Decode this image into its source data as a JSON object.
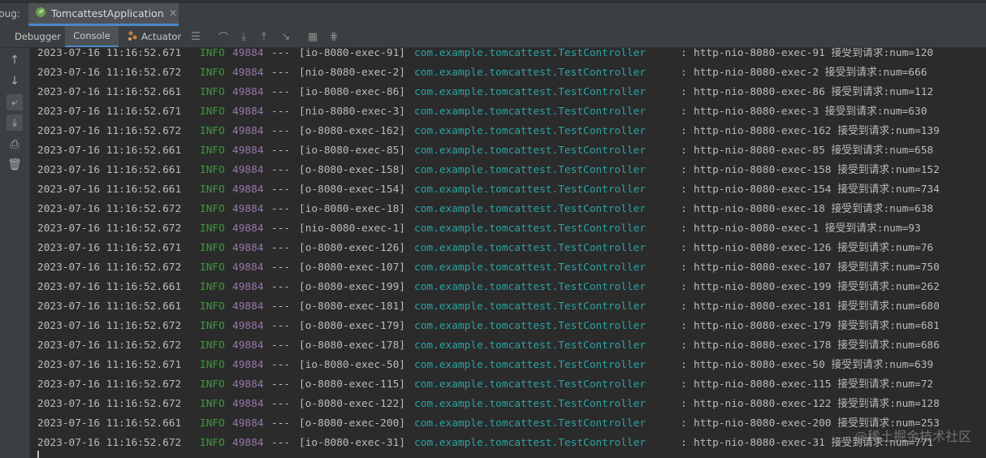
{
  "header": {
    "debug_label": "bug:",
    "app_tab_title": "TomcattestApplication",
    "close_glyph": "×"
  },
  "toolbar": {
    "tabs": [
      "Debugger",
      "Console",
      "Actuator"
    ],
    "icons": [
      "menu-icon",
      "restore-layout-icon",
      "step-over-icon",
      "step-into-icon",
      "step-out-icon",
      "run-to-cursor-icon",
      "evaluate-icon",
      "trace-icon"
    ]
  },
  "sidebar": {
    "icons": [
      "up-arrow-icon",
      "down-arrow-icon",
      "soft-wrap-icon",
      "scroll-to-end-icon",
      "print-icon",
      "trash-icon"
    ]
  },
  "colors": {
    "level": "#3d9a3d",
    "pid": "#9876aa",
    "logger": "#2ba3a3",
    "accent": "#4a88c7"
  },
  "console": {
    "lines": [
      {
        "date": "2023-07-16 11:16:52.671",
        "level": "INFO",
        "pid": "49884",
        "sep": "---",
        "thread": "[io-8080-exec-91]",
        "logger": "com.example.tomcattest.TestController",
        "colon": ":",
        "msg": "http-nio-8080-exec-91 接受到请求:num=120"
      },
      {
        "date": "2023-07-16 11:16:52.672",
        "level": "INFO",
        "pid": "49884",
        "sep": "---",
        "thread": "[nio-8080-exec-2]",
        "logger": "com.example.tomcattest.TestController",
        "colon": ":",
        "msg": "http-nio-8080-exec-2 接受到请求:num=666"
      },
      {
        "date": "2023-07-16 11:16:52.661",
        "level": "INFO",
        "pid": "49884",
        "sep": "---",
        "thread": "[io-8080-exec-86]",
        "logger": "com.example.tomcattest.TestController",
        "colon": ":",
        "msg": "http-nio-8080-exec-86 接受到请求:num=112"
      },
      {
        "date": "2023-07-16 11:16:52.671",
        "level": "INFO",
        "pid": "49884",
        "sep": "---",
        "thread": "[nio-8080-exec-3]",
        "logger": "com.example.tomcattest.TestController",
        "colon": ":",
        "msg": "http-nio-8080-exec-3 接受到请求:num=630"
      },
      {
        "date": "2023-07-16 11:16:52.672",
        "level": "INFO",
        "pid": "49884",
        "sep": "---",
        "thread": "[o-8080-exec-162]",
        "logger": "com.example.tomcattest.TestController",
        "colon": ":",
        "msg": "http-nio-8080-exec-162 接受到请求:num=139"
      },
      {
        "date": "2023-07-16 11:16:52.661",
        "level": "INFO",
        "pid": "49884",
        "sep": "---",
        "thread": "[io-8080-exec-85]",
        "logger": "com.example.tomcattest.TestController",
        "colon": ":",
        "msg": "http-nio-8080-exec-85 接受到请求:num=658"
      },
      {
        "date": "2023-07-16 11:16:52.661",
        "level": "INFO",
        "pid": "49884",
        "sep": "---",
        "thread": "[o-8080-exec-158]",
        "logger": "com.example.tomcattest.TestController",
        "colon": ":",
        "msg": "http-nio-8080-exec-158 接受到请求:num=152"
      },
      {
        "date": "2023-07-16 11:16:52.661",
        "level": "INFO",
        "pid": "49884",
        "sep": "---",
        "thread": "[o-8080-exec-154]",
        "logger": "com.example.tomcattest.TestController",
        "colon": ":",
        "msg": "http-nio-8080-exec-154 接受到请求:num=734"
      },
      {
        "date": "2023-07-16 11:16:52.672",
        "level": "INFO",
        "pid": "49884",
        "sep": "---",
        "thread": "[io-8080-exec-18]",
        "logger": "com.example.tomcattest.TestController",
        "colon": ":",
        "msg": "http-nio-8080-exec-18 接受到请求:num=638"
      },
      {
        "date": "2023-07-16 11:16:52.672",
        "level": "INFO",
        "pid": "49884",
        "sep": "---",
        "thread": "[nio-8080-exec-1]",
        "logger": "com.example.tomcattest.TestController",
        "colon": ":",
        "msg": "http-nio-8080-exec-1 接受到请求:num=93"
      },
      {
        "date": "2023-07-16 11:16:52.671",
        "level": "INFO",
        "pid": "49884",
        "sep": "---",
        "thread": "[o-8080-exec-126]",
        "logger": "com.example.tomcattest.TestController",
        "colon": ":",
        "msg": "http-nio-8080-exec-126 接受到请求:num=76"
      },
      {
        "date": "2023-07-16 11:16:52.672",
        "level": "INFO",
        "pid": "49884",
        "sep": "---",
        "thread": "[o-8080-exec-107]",
        "logger": "com.example.tomcattest.TestController",
        "colon": ":",
        "msg": "http-nio-8080-exec-107 接受到请求:num=750"
      },
      {
        "date": "2023-07-16 11:16:52.661",
        "level": "INFO",
        "pid": "49884",
        "sep": "---",
        "thread": "[o-8080-exec-199]",
        "logger": "com.example.tomcattest.TestController",
        "colon": ":",
        "msg": "http-nio-8080-exec-199 接受到请求:num=262"
      },
      {
        "date": "2023-07-16 11:16:52.661",
        "level": "INFO",
        "pid": "49884",
        "sep": "---",
        "thread": "[o-8080-exec-181]",
        "logger": "com.example.tomcattest.TestController",
        "colon": ":",
        "msg": "http-nio-8080-exec-181 接受到请求:num=680"
      },
      {
        "date": "2023-07-16 11:16:52.672",
        "level": "INFO",
        "pid": "49884",
        "sep": "---",
        "thread": "[o-8080-exec-179]",
        "logger": "com.example.tomcattest.TestController",
        "colon": ":",
        "msg": "http-nio-8080-exec-179 接受到请求:num=681"
      },
      {
        "date": "2023-07-16 11:16:52.672",
        "level": "INFO",
        "pid": "49884",
        "sep": "---",
        "thread": "[o-8080-exec-178]",
        "logger": "com.example.tomcattest.TestController",
        "colon": ":",
        "msg": "http-nio-8080-exec-178 接受到请求:num=686"
      },
      {
        "date": "2023-07-16 11:16:52.671",
        "level": "INFO",
        "pid": "49884",
        "sep": "---",
        "thread": "[io-8080-exec-50]",
        "logger": "com.example.tomcattest.TestController",
        "colon": ":",
        "msg": "http-nio-8080-exec-50 接受到请求:num=639"
      },
      {
        "date": "2023-07-16 11:16:52.672",
        "level": "INFO",
        "pid": "49884",
        "sep": "---",
        "thread": "[o-8080-exec-115]",
        "logger": "com.example.tomcattest.TestController",
        "colon": ":",
        "msg": "http-nio-8080-exec-115 接受到请求:num=72"
      },
      {
        "date": "2023-07-16 11:16:52.672",
        "level": "INFO",
        "pid": "49884",
        "sep": "---",
        "thread": "[o-8080-exec-122]",
        "logger": "com.example.tomcattest.TestController",
        "colon": ":",
        "msg": "http-nio-8080-exec-122 接受到请求:num=128"
      },
      {
        "date": "2023-07-16 11:16:52.661",
        "level": "INFO",
        "pid": "49884",
        "sep": "---",
        "thread": "[o-8080-exec-200]",
        "logger": "com.example.tomcattest.TestController",
        "colon": ":",
        "msg": "http-nio-8080-exec-200 接受到请求:num=253"
      },
      {
        "date": "2023-07-16 11:16:52.672",
        "level": "INFO",
        "pid": "49884",
        "sep": "---",
        "thread": "[io-8080-exec-31]",
        "logger": "com.example.tomcattest.TestController",
        "colon": ":",
        "msg": "http-nio-8080-exec-31 接受到请求:num=771"
      }
    ]
  },
  "watermark": "@稀土掘金技术社区"
}
